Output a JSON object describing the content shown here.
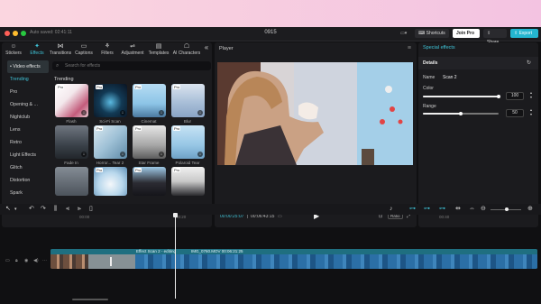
{
  "app": {
    "autosave": "Auto saved: 02:41:11",
    "project_title": "0915",
    "shortcuts_label": "Shortcuts",
    "join_pro_label": "Join Pro",
    "share_label": "Share",
    "export_label": "Export"
  },
  "tabs": [
    {
      "label": "Stickers",
      "icon": "sticker-icon"
    },
    {
      "label": "Effects",
      "icon": "effects-icon",
      "active": true
    },
    {
      "label": "Transitions",
      "icon": "transitions-icon"
    },
    {
      "label": "Captions",
      "icon": "captions-icon"
    },
    {
      "label": "Filters",
      "icon": "filters-icon"
    },
    {
      "label": "Adjustment",
      "icon": "adjustment-icon"
    },
    {
      "label": "Templates",
      "icon": "templates-icon"
    },
    {
      "label": "AI Characters",
      "icon": "ai-characters-icon"
    }
  ],
  "categories": {
    "header": "• Video effects",
    "items": [
      "Trending",
      "Pro",
      "Opening & ...",
      "Nightclub",
      "Lens",
      "Retro",
      "Light Effects",
      "Glitch",
      "Distortion",
      "Spark"
    ]
  },
  "search": {
    "placeholder": "Search for effects"
  },
  "section_title": "Trending",
  "effects": [
    {
      "label": "Flash",
      "pro": "Pro"
    },
    {
      "label": "Sci-Fi Scan",
      "pro": "Pro"
    },
    {
      "label": "Cinemat",
      "pro": "Pro"
    },
    {
      "label": "Blur",
      "pro": "Pro"
    },
    {
      "label": "Fade In",
      "pro": ""
    },
    {
      "label": "Horror... Tear 2",
      "pro": "Pro"
    },
    {
      "label": "Star Frame",
      "pro": "Pro"
    },
    {
      "label": "Polaroid Tear",
      "pro": "Pro"
    },
    {
      "label": "",
      "pro": ""
    },
    {
      "label": "",
      "pro": "Pro"
    },
    {
      "label": "",
      "pro": "Pro"
    },
    {
      "label": "",
      "pro": "Pro"
    }
  ],
  "player": {
    "title": "Player",
    "current_time": "00:00:25:07",
    "total_time": "00:06:43:15",
    "ratio_label": "Ratio"
  },
  "right_panel": {
    "title": "Special effects",
    "details_label": "Details",
    "name_label": "Name",
    "name_value": "Scan 2",
    "color_label": "Color",
    "color_value": "100",
    "color_fraction": 1.0,
    "range_label": "Range",
    "range_value": "50",
    "range_fraction": 0.5
  },
  "timeline": {
    "ticks": [
      "00:00",
      "00:20",
      "00:40"
    ],
    "effect_label": "Effect Scan 2 - editing",
    "clip_label": "IMG_0760.MOV  00:06:21:25"
  }
}
